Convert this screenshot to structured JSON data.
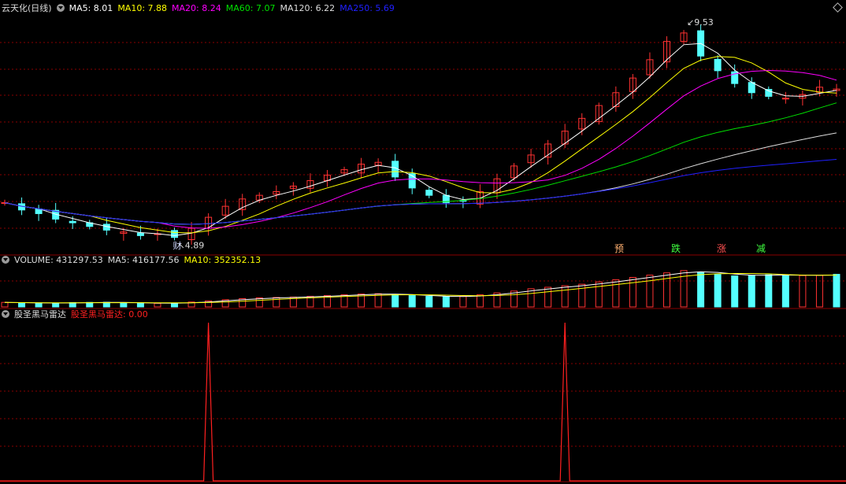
{
  "header": {
    "title": "云天化(日线)",
    "ma5": "MA5: 8.01",
    "ma10": "MA10: 7.88",
    "ma20": "MA20: 8.24",
    "ma60": "MA60: 7.07",
    "ma120": "MA120: 6.22",
    "ma250": "MA250: 5.69"
  },
  "volume_header": {
    "volume": "VOLUME: 431297.53",
    "ma5": "MA5: 416177.56",
    "ma10": "MA10: 352352.13"
  },
  "indicator_header": {
    "name": "股圣黑马雷达",
    "value": "股圣黑马雷达: 0.00"
  },
  "annotations": {
    "high": "9.53",
    "low": "4.89",
    "marker_cai": "财",
    "sig1": "预",
    "sig2": "跌",
    "sig3": "涨",
    "sig4": "减"
  },
  "colors": {
    "up": "#ff3232",
    "down": "#54ffff",
    "ma5": "#ffffff",
    "ma10": "#ffff00",
    "ma20": "#ff00ff",
    "ma60": "#00e000",
    "ma120": "#dddddd",
    "ma250": "#2020ff",
    "grid": "#8a0000",
    "indicator": "#ff2020"
  },
  "chart_data": [
    {
      "type": "line",
      "title": "云天化(日线)",
      "series": [
        {
          "name": "close",
          "values": [
            4.9,
            4.7,
            4.6,
            4.45,
            4.35,
            4.25,
            4.15,
            4.1,
            4.0,
            4.05,
            3.95,
            4.2,
            4.5,
            4.8,
            5.0,
            5.1,
            5.2,
            5.35,
            5.5,
            5.65,
            5.8,
            5.95,
            6.0,
            5.6,
            5.3,
            5.1,
            4.9,
            4.95,
            5.2,
            5.55,
            5.9,
            6.2,
            6.5,
            6.85,
            7.2,
            7.55,
            7.9,
            8.3,
            8.8,
            9.3,
            9.53,
            8.9,
            8.5,
            8.15,
            7.9,
            7.8,
            7.75,
            7.85,
            8.05,
            8.0
          ]
        }
      ],
      "annotations": {
        "high": 9.53,
        "low": 4.89
      }
    },
    {
      "type": "bar",
      "title": "VOLUME",
      "values_note": "",
      "series": [
        {
          "name": "VOLUME",
          "values": [
            60,
            55,
            50,
            52,
            58,
            60,
            62,
            55,
            50,
            48,
            52,
            65,
            80,
            95,
            110,
            120,
            125,
            130,
            140,
            150,
            160,
            170,
            175,
            165,
            150,
            140,
            135,
            140,
            160,
            185,
            210,
            240,
            260,
            280,
            300,
            330,
            360,
            390,
            420,
            450,
            480,
            460,
            430,
            410,
            420,
            425,
            420,
            415,
            418,
            431
          ]
        }
      ]
    },
    {
      "type": "line",
      "title": "股圣黑马雷达",
      "series": [
        {
          "name": "股圣黑马雷达",
          "values": [
            0,
            0,
            0,
            0,
            0,
            0,
            0,
            0,
            0,
            0,
            0,
            0,
            0,
            0,
            0,
            0,
            0,
            0,
            0,
            0,
            0,
            0,
            0,
            0,
            0,
            0,
            0,
            0,
            0,
            0,
            0,
            0,
            0,
            0,
            0,
            0,
            0,
            0,
            0,
            0,
            0,
            0,
            0,
            0,
            0,
            0,
            0,
            0,
            0,
            0
          ]
        }
      ],
      "spikes": [
        {
          "index": 12,
          "value": 1
        },
        {
          "index": 33,
          "value": 1
        }
      ]
    }
  ]
}
